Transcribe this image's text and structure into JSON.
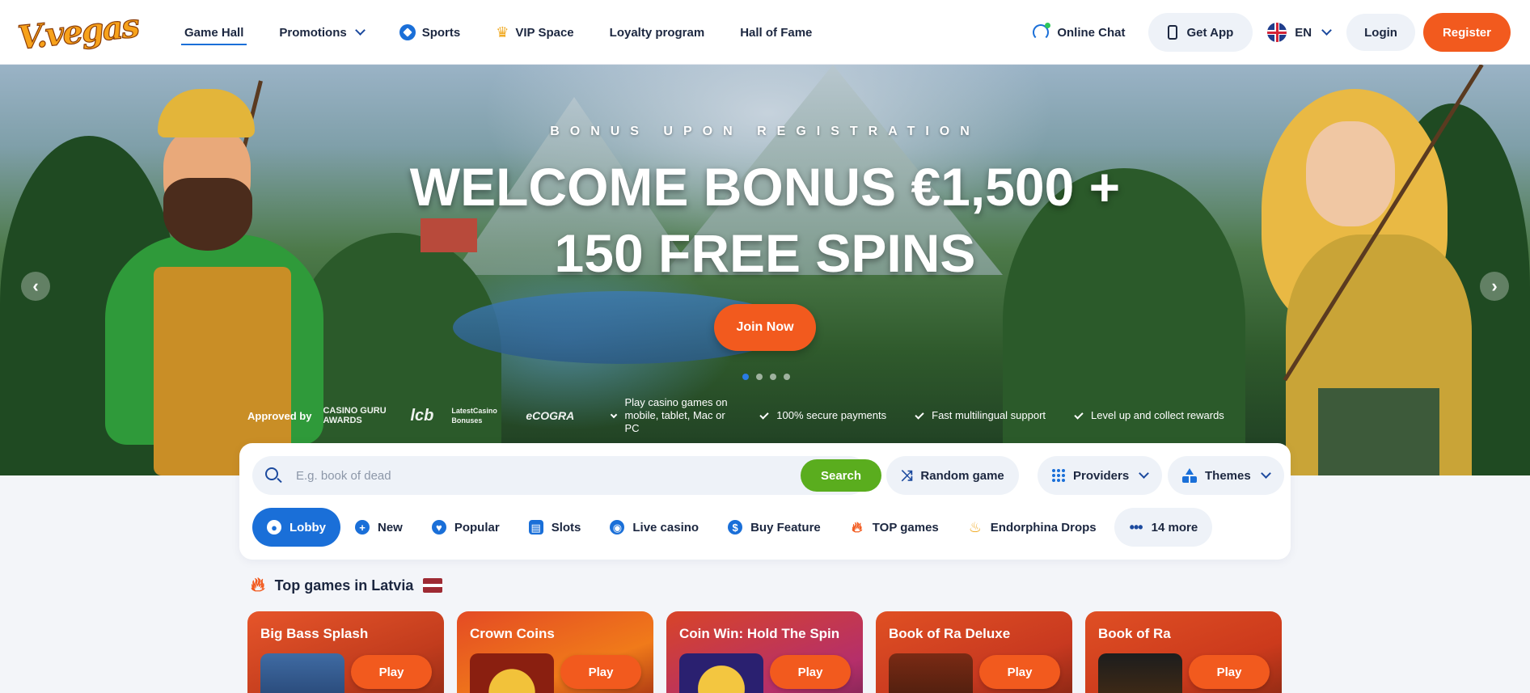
{
  "brand": {
    "logo_text": "V.vegas"
  },
  "nav": {
    "items": [
      {
        "label": "Game Hall"
      },
      {
        "label": "Promotions"
      },
      {
        "label": "Sports"
      },
      {
        "label": "VIP Space"
      },
      {
        "label": "Loyalty program"
      },
      {
        "label": "Hall of Fame"
      }
    ]
  },
  "header_right": {
    "chat_label": "Online Chat",
    "get_app_label": "Get App",
    "language": "EN",
    "login_label": "Login",
    "register_label": "Register"
  },
  "hero": {
    "eyebrow": "BONUS UPON REGISTRATION",
    "title_line1": "WELCOME BONUS €1,500 +",
    "title_line2": "150 FREE SPINS",
    "cta_label": "Join Now",
    "slide_count": 4,
    "active_slide": 1,
    "approved_label": "Approved by",
    "badges": [
      "CASINO GURU AWARDS",
      "lcb",
      "LatestCasino Bonuses",
      "eCOGRA"
    ],
    "features": [
      "Play casino games on mobile, tablet, Mac or PC",
      "100% secure payments",
      "Fast multilingual support",
      "Level up and collect rewards"
    ]
  },
  "search": {
    "placeholder": "E.g. book of dead",
    "value": "",
    "button_label": "Search",
    "random_label": "Random game",
    "providers_label": "Providers",
    "themes_label": "Themes"
  },
  "categories": [
    {
      "label": "Lobby",
      "icon": "medal-icon"
    },
    {
      "label": "New",
      "icon": "plus-icon"
    },
    {
      "label": "Popular",
      "icon": "heart-icon"
    },
    {
      "label": "Slots",
      "icon": "slot-machine-icon"
    },
    {
      "label": "Live casino",
      "icon": "live-icon"
    },
    {
      "label": "Buy Feature",
      "icon": "dollar-icon"
    },
    {
      "label": "TOP games",
      "icon": "flame-icon"
    },
    {
      "label": "Endorphina Drops",
      "icon": "drop-icon"
    },
    {
      "label": "14 more",
      "icon": "more-dots-icon"
    }
  ],
  "top_games": {
    "title": "Top games in Latvia",
    "games": [
      {
        "name": "Big Bass Splash",
        "play_label": "Play"
      },
      {
        "name": "Crown Coins",
        "play_label": "Play"
      },
      {
        "name": "Coin Win: Hold The Spin",
        "play_label": "Play"
      },
      {
        "name": "Book of Ra Deluxe",
        "play_label": "Play"
      },
      {
        "name": "Book of Ra",
        "play_label": "Play"
      }
    ]
  },
  "colors": {
    "accent_orange": "#f25a1e",
    "accent_blue": "#1a6fd8",
    "search_green": "#5aad1e"
  }
}
